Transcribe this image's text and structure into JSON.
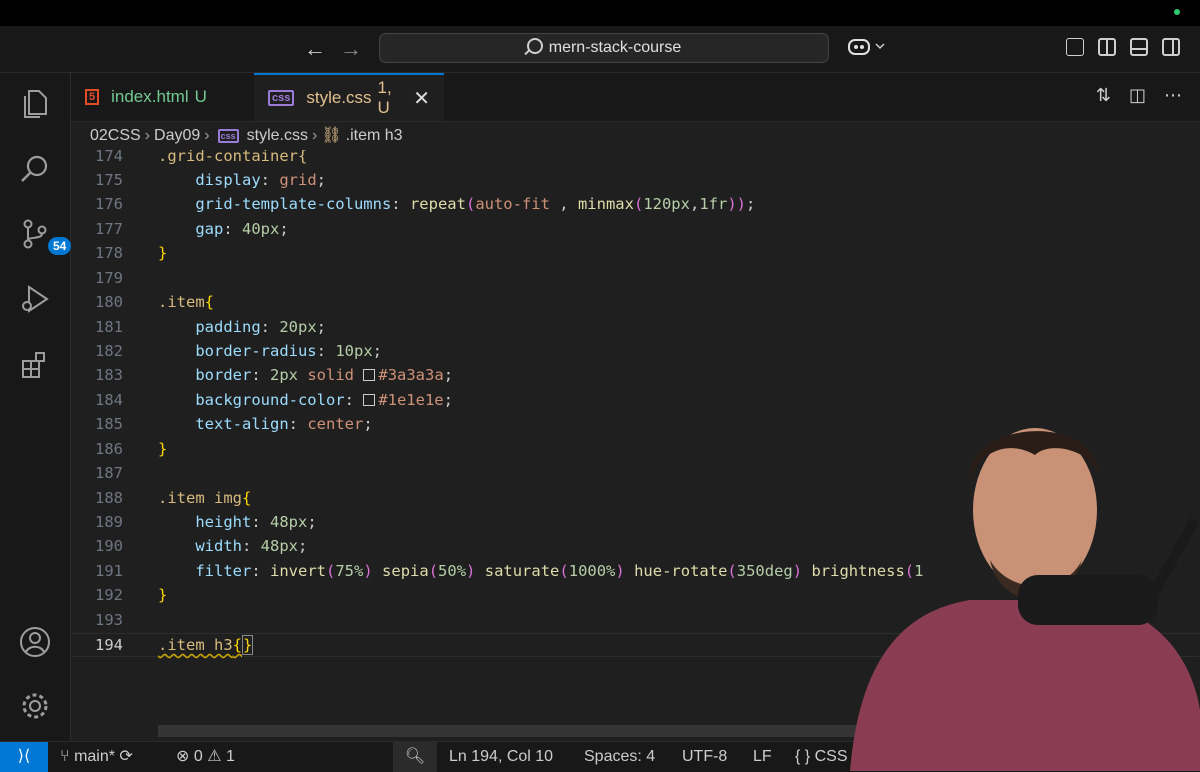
{
  "titlebar": {
    "back_icon": "arrow-left-icon",
    "forward_icon": "arrow-right-icon",
    "search_text": "mern-stack-course"
  },
  "activity_bar": {
    "items": [
      {
        "name": "explorer",
        "icon": "files-icon"
      },
      {
        "name": "search",
        "icon": "search-icon"
      },
      {
        "name": "source-control",
        "icon": "source-control-icon",
        "badge": "54"
      },
      {
        "name": "run-debug",
        "icon": "run-debug-icon"
      },
      {
        "name": "extensions",
        "icon": "extensions-icon"
      }
    ],
    "bottom": [
      {
        "name": "accounts",
        "icon": "account-icon"
      },
      {
        "name": "manage",
        "icon": "gear-icon"
      }
    ]
  },
  "tabs": [
    {
      "label": "index.html",
      "status": "U",
      "type": "HTML",
      "active": false
    },
    {
      "label": "style.css",
      "status": "1, U",
      "type": "CSS",
      "active": true
    }
  ],
  "breadcrumb": {
    "folder1": "02CSS",
    "folder2": "Day09",
    "file": "style.css",
    "symbol": ".item h3"
  },
  "editor": {
    "current_line": 194,
    "lines": [
      {
        "n": "174",
        "text": ".grid-container{"
      },
      {
        "n": "175",
        "text": "    display: grid;"
      },
      {
        "n": "176",
        "text": "    grid-template-columns: repeat(auto-fit , minmax(120px,1fr));"
      },
      {
        "n": "177",
        "text": "    gap: 40px;"
      },
      {
        "n": "178",
        "text": "}"
      },
      {
        "n": "179",
        "text": ""
      },
      {
        "n": "180",
        "text": ".item{"
      },
      {
        "n": "181",
        "text": "    padding: 20px;"
      },
      {
        "n": "182",
        "text": "    border-radius: 10px;"
      },
      {
        "n": "183",
        "text": "    border: 2px solid #3a3a3a;"
      },
      {
        "n": "184",
        "text": "    background-color: #1e1e1e;"
      },
      {
        "n": "185",
        "text": "    text-align: center;"
      },
      {
        "n": "186",
        "text": "}"
      },
      {
        "n": "187",
        "text": ""
      },
      {
        "n": "188",
        "text": ".item img{"
      },
      {
        "n": "189",
        "text": "    height: 48px;"
      },
      {
        "n": "190",
        "text": "    width: 48px;"
      },
      {
        "n": "191",
        "text": "    filter: invert(75%) sepia(50%) saturate(1000%) hue-rotate(350deg) brightness(1"
      },
      {
        "n": "192",
        "text": "}"
      },
      {
        "n": "193",
        "text": ""
      },
      {
        "n": "194",
        "text": ".item h3{}"
      }
    ]
  },
  "statusbar": {
    "branch": "main*",
    "errors": "0",
    "warnings": "1",
    "position": "Ln 194, Col 10",
    "spaces": "Spaces: 4",
    "encoding": "UTF-8",
    "eol": "LF",
    "language": "CSS"
  },
  "colors": {
    "accent": "#0078d4",
    "selector": "#d7ba7d",
    "property": "#9cdcfe",
    "value": "#ce9178",
    "number": "#b5cea8",
    "function": "#dcdcaa",
    "modified": "#73c991"
  }
}
